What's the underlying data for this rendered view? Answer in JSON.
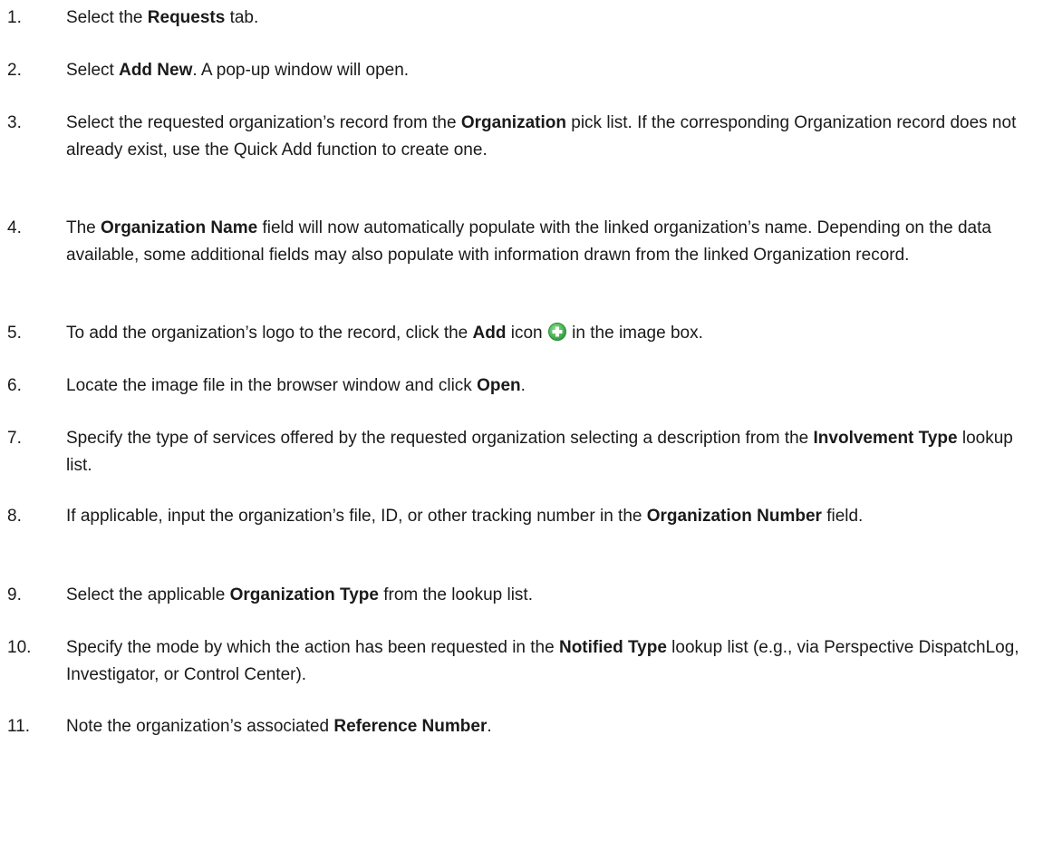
{
  "steps": [
    {
      "num": "1.",
      "a": "Select the ",
      "b1": "Requests",
      "c": " tab."
    },
    {
      "num": "2.",
      "a": "Select ",
      "b1": "Add New",
      "c": ". A pop-up window will open."
    },
    {
      "num": "3.",
      "a": "Select the requested organization’s record from the ",
      "b1": "Organization",
      "c": " pick list. If the corresponding Organization record does not already exist, use the Quick Add function to create one."
    },
    {
      "num": "4.",
      "a": "The ",
      "b1": "Organization Name",
      "c": " field will now automatically populate with the linked organization’s name. Depending on the data available, some additional fields may also populate with information drawn from the linked Organization record."
    },
    {
      "num": "5.",
      "a": "To add the organization’s logo to the record, click the ",
      "b1": "Add",
      "c": " icon",
      "d": " in the image box."
    },
    {
      "num": "6.",
      "a": "Locate the image file in the browser window and click ",
      "b1": "Open",
      "c": "."
    },
    {
      "num": "7.",
      "a": "Specify the type of services offered by the requested organization selecting a description from the ",
      "b1": "Involvement Type",
      "c": " lookup list."
    },
    {
      "num": "8.",
      "a": "If applicable, input the organization’s file, ID, or other tracking number in the ",
      "b1": "Organization Number",
      "c": " field."
    },
    {
      "num": "9.",
      "a": "Select the applicable ",
      "b1": "Organization Type",
      "c": " from the lookup list."
    },
    {
      "num": "10.",
      "a": "Specify the mode by which the action has been requested in the ",
      "b1": "Notified Type",
      "c": " lookup list (e.g., via Perspective DispatchLog, Investigator, or Control Center)."
    },
    {
      "num": "11.",
      "a": "Note the organization’s associated ",
      "b1": "Reference Number",
      "c": "."
    }
  ],
  "icons": {
    "add_icon": "add-plus-icon",
    "add_icon_color": "#3fb34f"
  }
}
